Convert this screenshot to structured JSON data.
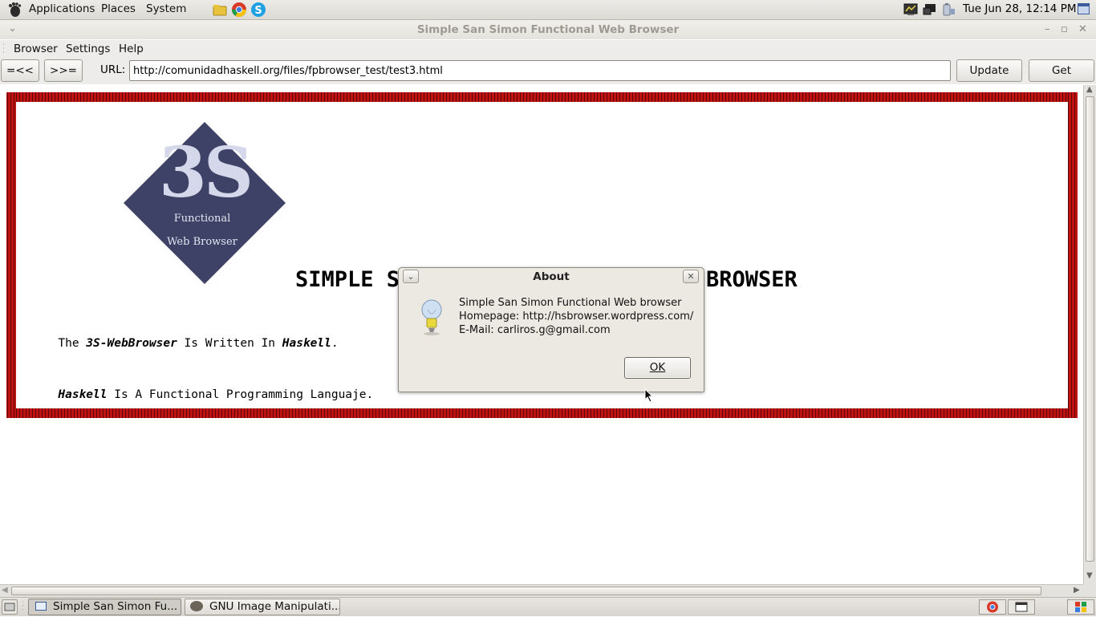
{
  "top_panel": {
    "menus": [
      "Applications",
      "Places",
      "System"
    ],
    "launchers": [
      "folder-icon",
      "chrome-icon",
      "skype-icon"
    ],
    "clock": "Tue Jun 28, 12:14 PM"
  },
  "window": {
    "title": "Simple San Simon Functional Web Browser"
  },
  "menubar": {
    "items": [
      "Browser",
      "Settings",
      "Help"
    ]
  },
  "toolbar": {
    "back_label": "=<<",
    "forward_label": ">>=",
    "url_label": "URL:",
    "url_value": "http://comunidadhaskell.org/files/fpbrowser_test/test3.html",
    "update_label": "Update",
    "get_label": "Get"
  },
  "page": {
    "logo_big": "3S",
    "logo_line1": "Functional",
    "logo_line2": "Web Browser",
    "heading_left": "SIMPLE S",
    "heading_right": "BROWSER",
    "para1": {
      "pre": "The ",
      "em1": "3S-WebBrowser",
      "mid": " Is Written In ",
      "em2": "Haskell",
      "post": "."
    },
    "para2": {
      "em": "Haskell",
      "post": " Is A Functional Programming Languaje."
    }
  },
  "dialog": {
    "title": "About",
    "line1": "Simple San Simon Functional Web browser",
    "line2": "Homepage: http://hsbrowser.wordpress.com/",
    "line3": "E-Mail: carliros.g@gmail.com",
    "ok_label": "OK"
  },
  "taskbar": {
    "tasks": [
      "Simple San Simon Fu...",
      "GNU Image Manipulati..."
    ]
  },
  "colors": {
    "frame_border": "#c11212",
    "logo_diamond": "#3d4266",
    "logo_text": "#d4d8ea"
  }
}
